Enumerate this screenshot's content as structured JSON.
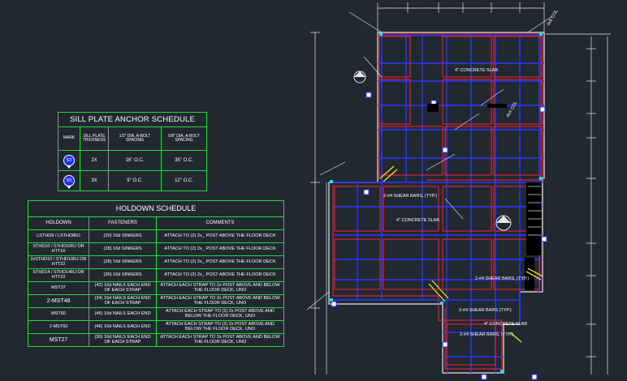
{
  "sill_plate": {
    "title": "SILL PLATE ANCHOR SCHEDULE",
    "headers": [
      "MARK",
      "SILL PLATE THICKNESS",
      "1/2\" DIA. A-BOLT SPACING",
      "5/8\" DIA. A-BOLT SPACING"
    ],
    "rows": [
      {
        "mark": "S3",
        "thickness": "2X",
        "half": "16\" O.C.",
        "five_eighths": "35\" O.C."
      },
      {
        "mark": "S5",
        "thickness": "3X",
        "half": "9\" O.C.",
        "five_eighths": "12\" O.C."
      }
    ]
  },
  "holdown": {
    "title": "HOLDOWN SCHEDULE",
    "headers": [
      "HOLDOWN",
      "FASTENERS",
      "COMMENTS"
    ],
    "rows": [
      {
        "holdown": "LSTHD8 / LSTHD8RJ",
        "fasteners": "(20) 16d SINKERS",
        "comments": "ATTACH TO (2) 2x_ POST ABOVE THE FLOOR DECK"
      },
      {
        "holdown": "STHD10 / STHD10RJ OR HTT16",
        "fasteners": "(28) 16d SINKERS",
        "comments": "ATTACH TO (2) 2x_ POST ABOVE THE FLOOR DECK"
      },
      {
        "holdown": "2xSTHD10 / STHD10RJ OR HTT22",
        "fasteners": "(28) 16d SINKERS",
        "comments": "ATTACH TO (2) 2x_ POST ABOVE THE FLOOR DECK"
      },
      {
        "holdown": "STHD14 / STHD14RJ OR HTT22",
        "fasteners": "(30) 16d SINKERS",
        "comments": "ATTACH TO (2) 2x_ POST ABOVE THE FLOOR DECK"
      },
      {
        "holdown": "MST37",
        "fasteners": "(42) 16d NAILS EACH END OF EACH STRAP",
        "comments": "ATTACH EACH STRAP TO 2x POST ABOVE AND BELOW THE FLOOR DECK, UNO"
      },
      {
        "holdown": "2-MST48",
        "fasteners": "(34) 16d NAILS EACH END OF EACH STRAP",
        "comments": "ATTACH EACH STRAP TO 2x POST ABOVE AND BELOW THE FLOOR DECK, UNO"
      },
      {
        "holdown": "MST60",
        "fasteners": "(46) 16d NAILS EACH END",
        "comments": "ATTACH EACH STRAP TO (2) 2x POST ABOVE AND BELOW THE FLOOR DECK, UNO"
      },
      {
        "holdown": "2-MST60",
        "fasteners": "(46) 16d NAILS EACH END",
        "comments": "ATTACH EACH STRAP TO (2) 2x POST ABOVE AND BELOW THE FLOOR DECK, UNO"
      },
      {
        "holdown": "MST27",
        "fasteners": "(30) 16d NAILS EACH END OF EACH STRAP",
        "comments": "ATTACH EACH STRAP TO 2x POST ABOVE AND BELOW THE FLOOR DECK, UNO"
      }
    ]
  },
  "plan_labels": {
    "slab_top": "4\" CONCRETE SLAB",
    "slab_mid": "4\" CONCRETE SLAB",
    "slab_bottom": "4\" CONCRETE SLAB",
    "shear_1": "2-#4 SHEAR BARS, (TYP.)",
    "shear_2": "2-#4 SHEAR BARS, (TYP.)",
    "shear_3": "2-#4 SHEAR BARS (TYP.)",
    "shear_4": "2-#4 SHEAR BARS, (TYP.)",
    "col": "4x6 COL",
    "col2": "4x4 COL",
    "stair": "4x4 COL"
  },
  "colors": {
    "background": "#212830",
    "table_border": "#27d63a",
    "grid_blue": "#2a37ff",
    "grid_red": "#ff1f2f",
    "cyan": "#1fe0e8",
    "yellow": "#f0e020",
    "dimension": "#e8e8e8"
  }
}
